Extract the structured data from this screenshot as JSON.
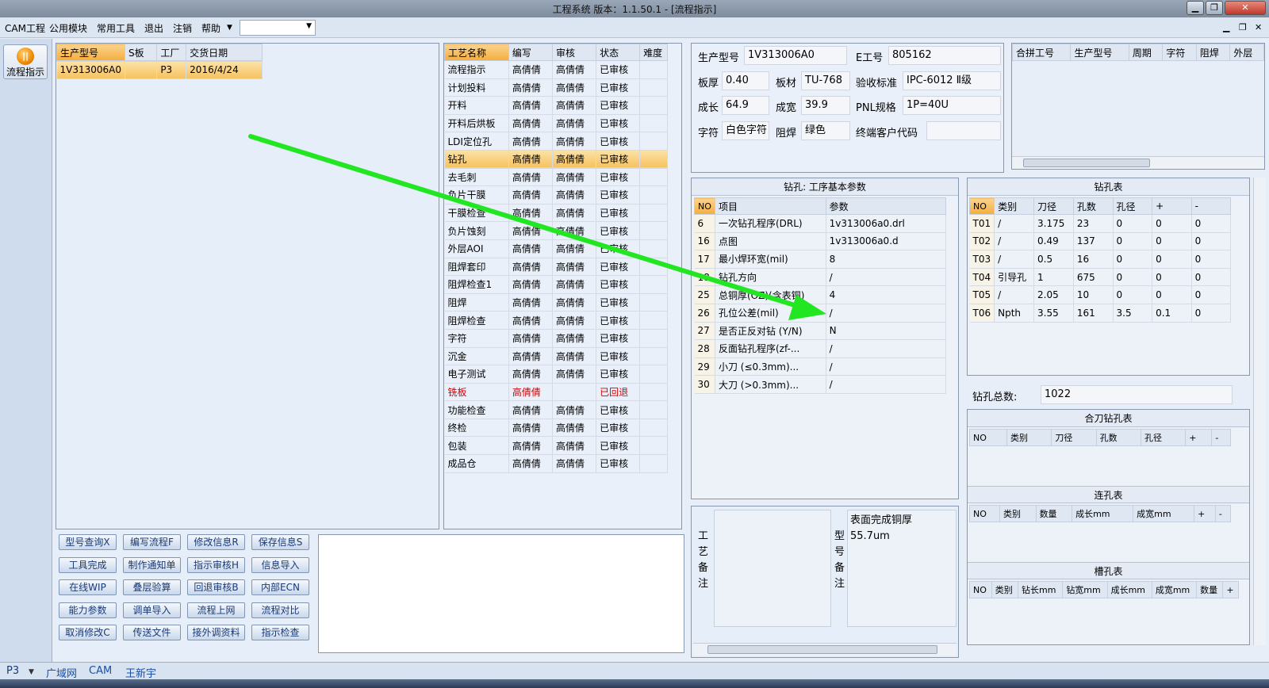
{
  "window": {
    "title": "工程系统   版本：1.1.50.1 - [流程指示]"
  },
  "menu": {
    "items": [
      "CAM工程",
      "公用模块",
      "常用工具",
      "退出",
      "注销",
      "帮助"
    ],
    "combo_value": ""
  },
  "sidebar": {
    "flow_button": "流程指示"
  },
  "order_table": {
    "headers": [
      "生产型号",
      "S板",
      "工厂",
      "交货日期"
    ],
    "rows": [
      {
        "model": "1V313006A0",
        "s": "",
        "factory": "P3",
        "date": "2016/4/24"
      }
    ]
  },
  "process_table": {
    "headers": [
      "工艺名称",
      "编写",
      "审核",
      "状态",
      "难度"
    ],
    "rows": [
      [
        "流程指示",
        "高倩倩",
        "高倩倩",
        "已审核",
        ""
      ],
      [
        "计划投料",
        "高倩倩",
        "高倩倩",
        "已审核",
        ""
      ],
      [
        "开料",
        "高倩倩",
        "高倩倩",
        "已审核",
        ""
      ],
      [
        "开料后烘板",
        "高倩倩",
        "高倩倩",
        "已审核",
        ""
      ],
      [
        "LDI定位孔",
        "高倩倩",
        "高倩倩",
        "已审核",
        ""
      ],
      [
        "钻孔",
        "高倩倩",
        "高倩倩",
        "已审核",
        ""
      ],
      [
        "去毛刺",
        "高倩倩",
        "高倩倩",
        "已审核",
        ""
      ],
      [
        "负片干膜",
        "高倩倩",
        "高倩倩",
        "已审核",
        ""
      ],
      [
        "干膜检查",
        "高倩倩",
        "高倩倩",
        "已审核",
        ""
      ],
      [
        "负片蚀刻",
        "高倩倩",
        "高倩倩",
        "已审核",
        ""
      ],
      [
        "外层AOI",
        "高倩倩",
        "高倩倩",
        "已审核",
        ""
      ],
      [
        "阻焊套印",
        "高倩倩",
        "高倩倩",
        "已审核",
        ""
      ],
      [
        "阻焊检查1",
        "高倩倩",
        "高倩倩",
        "已审核",
        ""
      ],
      [
        "阻焊",
        "高倩倩",
        "高倩倩",
        "已审核",
        ""
      ],
      [
        "阻焊检查",
        "高倩倩",
        "高倩倩",
        "已审核",
        ""
      ],
      [
        "字符",
        "高倩倩",
        "高倩倩",
        "已审核",
        ""
      ],
      [
        "沉金",
        "高倩倩",
        "高倩倩",
        "已审核",
        ""
      ],
      [
        "电子测试",
        "高倩倩",
        "高倩倩",
        "已审核",
        ""
      ],
      [
        "铣板",
        "高倩倩",
        "",
        "已回退",
        ""
      ],
      [
        "功能检查",
        "高倩倩",
        "高倩倩",
        "已审核",
        ""
      ],
      [
        "终检",
        "高倩倩",
        "高倩倩",
        "已审核",
        ""
      ],
      [
        "包装",
        "高倩倩",
        "高倩倩",
        "已审核",
        ""
      ],
      [
        "成品仓",
        "高倩倩",
        "高倩倩",
        "已审核",
        ""
      ]
    ],
    "selected_index": 5,
    "returned_index": 18
  },
  "buttons": [
    [
      "型号查询X",
      "编写流程F",
      "修改信息R",
      "保存信息S"
    ],
    [
      "工具完成",
      "制作通知单",
      "指示审核H",
      "信息导入"
    ],
    [
      "在线WIP",
      "叠层验算",
      "回退审核B",
      "内部ECN"
    ],
    [
      "能力参数",
      "调单导入",
      "流程上网",
      "流程对比"
    ],
    [
      "取消修改C",
      "传送文件",
      "接外调资料",
      "指示检查"
    ]
  ],
  "info": {
    "model_label": "生产型号",
    "model": "1V313006A0",
    "e_label": "E工号",
    "e_no": "805162",
    "thickness_label": "板厚",
    "thickness": "0.40",
    "material_label": "板材",
    "material": "TU-768",
    "standard_label": "验收标准",
    "standard": "IPC-6012 Ⅱ级",
    "length_label": "成长",
    "length": "64.9",
    "width_label": "成宽",
    "width": "39.9",
    "pnl_label": "PNL规格",
    "pnl": "1P=40U",
    "char_label": "字符",
    "char": "白色字符",
    "mask_label": "阻焊",
    "mask": "绿色",
    "customer_label": "终端客户代码",
    "customer": ""
  },
  "combine_table": {
    "headers": [
      "合拼工号",
      "生产型号",
      "周期",
      "字符",
      "阻焊",
      "外层"
    ]
  },
  "params": {
    "title": "钻孔: 工序基本参数",
    "headers": [
      "NO",
      "项目",
      "参数"
    ],
    "rows": [
      [
        "6",
        "一次钻孔程序(DRL)",
        "1v313006a0.drl"
      ],
      [
        "16",
        "点图",
        "1v313006a0.d"
      ],
      [
        "17",
        "最小焊环宽(mil)",
        "8"
      ],
      [
        "18",
        "钻孔方向",
        "/"
      ],
      [
        "25",
        "总铜厚(OZ)(含表铜)",
        "4"
      ],
      [
        "26",
        "孔位公差(mil)",
        "/"
      ],
      [
        "27",
        "是否正反对钻 (Y/N)",
        "N"
      ],
      [
        "28",
        "反面钻孔程序(zf-...",
        "/"
      ],
      [
        "29",
        "小刀 (≤0.3mm)...",
        "/"
      ],
      [
        "30",
        "大刀 (>0.3mm)...",
        "/"
      ]
    ]
  },
  "drill_table": {
    "title": "钻孔表",
    "headers": [
      "NO",
      "类别",
      "刀径",
      "孔数",
      "孔径",
      "+",
      "-"
    ],
    "rows": [
      [
        "T01",
        "/",
        "3.175",
        "23",
        "0",
        "0",
        "0"
      ],
      [
        "T02",
        "/",
        "0.49",
        "137",
        "0",
        "0",
        "0"
      ],
      [
        "T03",
        "/",
        "0.5",
        "16",
        "0",
        "0",
        "0"
      ],
      [
        "T04",
        "引导孔",
        "1",
        "675",
        "0",
        "0",
        "0"
      ],
      [
        "T05",
        "/",
        "2.05",
        "10",
        "0",
        "0",
        "0"
      ],
      [
        "T06",
        "Npth",
        "3.55",
        "161",
        "3.5",
        "0.1",
        "0"
      ]
    ],
    "total_label": "钻孔总数:",
    "total": "1022"
  },
  "combo_drill": {
    "title": "合刀钻孔表",
    "headers": [
      "NO",
      "类别",
      "刀径",
      "孔数",
      "孔径",
      "+",
      "-"
    ]
  },
  "link_holes": {
    "title": "连孔表",
    "headers": [
      "NO",
      "类别",
      "数量",
      "成长mm",
      "成宽mm",
      "+",
      "-"
    ]
  },
  "slot_holes": {
    "title": "槽孔表",
    "headers": [
      "NO",
      "类别",
      "钻长mm",
      "钻宽mm",
      "成长mm",
      "成宽mm",
      "数量",
      "+"
    ]
  },
  "remarks": {
    "process_label": "工艺备注",
    "model_label": "型号备注",
    "model_text": [
      "表面完成铜厚",
      "55.7um"
    ]
  },
  "statusbar": {
    "items": [
      "P3",
      "广域网",
      "CAM",
      "王新宇"
    ]
  },
  "colors": {
    "highlight": "#f6c25e",
    "arrow": "#22e622",
    "returned": "#d20000"
  }
}
